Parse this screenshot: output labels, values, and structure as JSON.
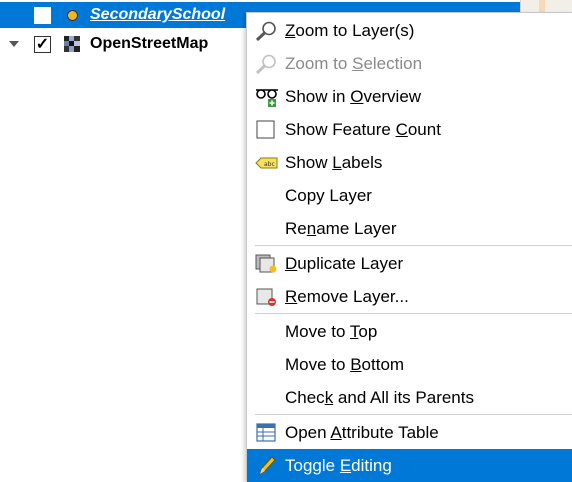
{
  "layers": [
    {
      "name": "SecondarySchool",
      "checked": false,
      "selected": true,
      "icon": "point-layer-icon"
    },
    {
      "name": "OpenStreetMap",
      "checked": true,
      "selected": false,
      "icon": "raster-layer-icon",
      "check_glyph": "✓"
    }
  ],
  "menu": {
    "items": [
      {
        "pre": "",
        "acc": "Z",
        "post": "oom to Layer(s)",
        "icon": "zoom-icon",
        "enabled": true
      },
      {
        "pre": "Zoom to ",
        "acc": "S",
        "post": "election",
        "icon": "zoom-icon",
        "enabled": false
      },
      {
        "pre": "Show in ",
        "acc": "O",
        "post": "verview",
        "icon": "glasses-add-icon",
        "enabled": true
      },
      {
        "pre": "Show Feature ",
        "acc": "C",
        "post": "ount",
        "icon": "checkbox-icon",
        "enabled": true
      },
      {
        "pre": "Show ",
        "acc": "L",
        "post": "abels",
        "icon": "label-tag-icon",
        "enabled": true
      },
      {
        "pre": "Copy Layer",
        "acc": "",
        "post": "",
        "icon": "",
        "enabled": true
      },
      {
        "pre": "Re",
        "acc": "n",
        "post": "ame Layer",
        "icon": "",
        "enabled": true
      },
      {
        "pre": "",
        "acc": "D",
        "post": "uplicate Layer",
        "icon": "duplicate-layer-icon",
        "enabled": true
      },
      {
        "pre": "",
        "acc": "R",
        "post": "emove Layer...",
        "icon": "remove-layer-icon",
        "enabled": true
      },
      {
        "pre": "Move to ",
        "acc": "T",
        "post": "op",
        "icon": "",
        "enabled": true
      },
      {
        "pre": "Move to ",
        "acc": "B",
        "post": "ottom",
        "icon": "",
        "enabled": true
      },
      {
        "pre": "Chec",
        "acc": "k",
        "post": " and All its Parents",
        "icon": "",
        "enabled": true
      },
      {
        "pre": "Open ",
        "acc": "A",
        "post": "ttribute Table",
        "icon": "attribute-table-icon",
        "enabled": true
      },
      {
        "pre": "Toggle ",
        "acc": "E",
        "post": "diting",
        "icon": "pencil-icon",
        "enabled": true,
        "highlighted": true
      }
    ]
  },
  "colors": {
    "selection": "#0078d7",
    "point_symbol": "#f0b429"
  }
}
